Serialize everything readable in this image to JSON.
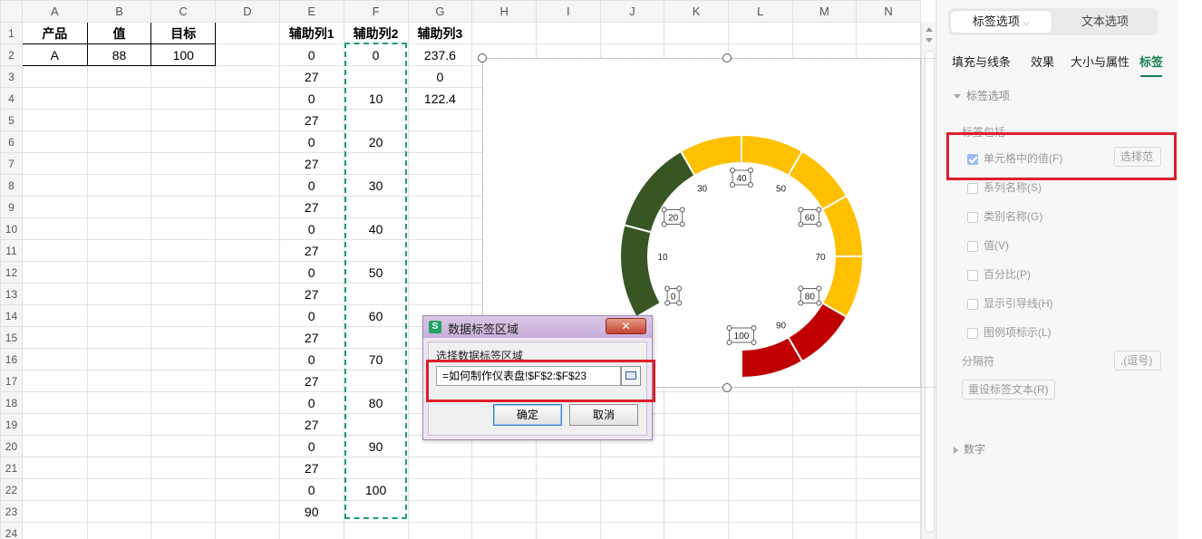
{
  "columns": [
    "A",
    "B",
    "C",
    "D",
    "E",
    "F",
    "G",
    "H",
    "I",
    "J",
    "K",
    "L",
    "M",
    "N"
  ],
  "rows": [
    [
      "产品",
      "值",
      "目标",
      "",
      "辅助列1",
      "辅助列2",
      "辅助列3",
      "",
      "",
      "",
      "",
      "",
      "",
      ""
    ],
    [
      "A",
      "88",
      "100",
      "",
      "0",
      "0",
      "237.6",
      "",
      "",
      "",
      "",
      "",
      "",
      ""
    ],
    [
      "",
      "",
      "",
      "",
      "27",
      "",
      "0",
      "",
      "",
      "",
      "",
      "",
      "",
      ""
    ],
    [
      "",
      "",
      "",
      "",
      "0",
      "10",
      "122.4",
      "",
      "",
      "",
      "",
      "",
      "",
      ""
    ],
    [
      "",
      "",
      "",
      "",
      "27",
      "",
      "",
      "",
      "",
      "",
      "",
      "",
      "",
      ""
    ],
    [
      "",
      "",
      "",
      "",
      "0",
      "20",
      "",
      "",
      "",
      "",
      "",
      "",
      "",
      ""
    ],
    [
      "",
      "",
      "",
      "",
      "27",
      "",
      "",
      "",
      "",
      "",
      "",
      "",
      "",
      ""
    ],
    [
      "",
      "",
      "",
      "",
      "0",
      "30",
      "",
      "",
      "",
      "",
      "",
      "",
      "",
      ""
    ],
    [
      "",
      "",
      "",
      "",
      "27",
      "",
      "",
      "",
      "",
      "",
      "",
      "",
      "",
      ""
    ],
    [
      "",
      "",
      "",
      "",
      "0",
      "40",
      "",
      "",
      "",
      "",
      "",
      "",
      "",
      ""
    ],
    [
      "",
      "",
      "",
      "",
      "27",
      "",
      "",
      "",
      "",
      "",
      "",
      "",
      "",
      ""
    ],
    [
      "",
      "",
      "",
      "",
      "0",
      "50",
      "",
      "",
      "",
      "",
      "",
      "",
      "",
      ""
    ],
    [
      "",
      "",
      "",
      "",
      "27",
      "",
      "",
      "",
      "",
      "",
      "",
      "",
      "",
      ""
    ],
    [
      "",
      "",
      "",
      "",
      "0",
      "60",
      "",
      "",
      "",
      "",
      "",
      "",
      "",
      ""
    ],
    [
      "",
      "",
      "",
      "",
      "27",
      "",
      "",
      "",
      "",
      "",
      "",
      "",
      "",
      ""
    ],
    [
      "",
      "",
      "",
      "",
      "0",
      "70",
      "",
      "",
      "",
      "",
      "",
      "",
      "",
      ""
    ],
    [
      "",
      "",
      "",
      "",
      "27",
      "",
      "",
      "",
      "",
      "",
      "",
      "",
      "",
      ""
    ],
    [
      "",
      "",
      "",
      "",
      "0",
      "80",
      "",
      "",
      "",
      "",
      "",
      "",
      "",
      ""
    ],
    [
      "",
      "",
      "",
      "",
      "27",
      "",
      "",
      "",
      "",
      "",
      "",
      "",
      "",
      ""
    ],
    [
      "",
      "",
      "",
      "",
      "0",
      "90",
      "",
      "",
      "",
      "",
      "",
      "",
      "",
      ""
    ],
    [
      "",
      "",
      "",
      "",
      "27",
      "",
      "",
      "",
      "",
      "",
      "",
      "",
      "",
      ""
    ],
    [
      "",
      "",
      "",
      "",
      "0",
      "100",
      "",
      "",
      "",
      "",
      "",
      "",
      "",
      ""
    ],
    [
      "",
      "",
      "",
      "",
      "90",
      "",
      "",
      "",
      "",
      "",
      "",
      "",
      "",
      ""
    ],
    [
      "",
      "",
      "",
      "",
      "",
      "",
      "",
      "",
      "",
      "",
      "",
      "",
      "",
      ""
    ]
  ],
  "chart_data": {
    "type": "gauge",
    "segments": [
      {
        "range": [
          0,
          30
        ],
        "color": "#375623",
        "count": 2
      },
      {
        "range": [
          30,
          80
        ],
        "color": "#FFC000",
        "count": 5
      },
      {
        "range": [
          80,
          100
        ],
        "color": "#C00000",
        "count": 2
      }
    ],
    "tick_labels": [
      "0",
      "10",
      "20",
      "30",
      "40",
      "50",
      "60",
      "70",
      "80",
      "90",
      "100"
    ]
  },
  "dialog": {
    "title": "数据标签区域",
    "app_icon": "S",
    "prompt": "选择数据标签区域",
    "range_value": "=如何制作仪表盘!$F$2:$F$23",
    "ok_label": "确定",
    "cancel_label": "取消"
  },
  "panel": {
    "tab_label_options": "标签选项",
    "tab_text_options": "文本选项",
    "subtabs": [
      "填充与线条",
      "效果",
      "大小与属性",
      "标签"
    ],
    "section_label_options": "标签选项",
    "label_contains": "标签包括",
    "options": [
      {
        "label": "单元格中的值(F)",
        "checked": true
      },
      {
        "label": "系列名称(S)",
        "checked": false
      },
      {
        "label": "类别名称(G)",
        "checked": false
      },
      {
        "label": "值(V)",
        "checked": false
      },
      {
        "label": "百分比(P)",
        "checked": false
      },
      {
        "label": "显示引导线(H)",
        "checked": false
      },
      {
        "label": "图例项标示(L)",
        "checked": false
      }
    ],
    "select_range_button": "选择范",
    "separator_label": "分隔符",
    "separator_value": ",(逗号)",
    "reset_button": "重设标签文本(R)",
    "section_number": "数字"
  }
}
